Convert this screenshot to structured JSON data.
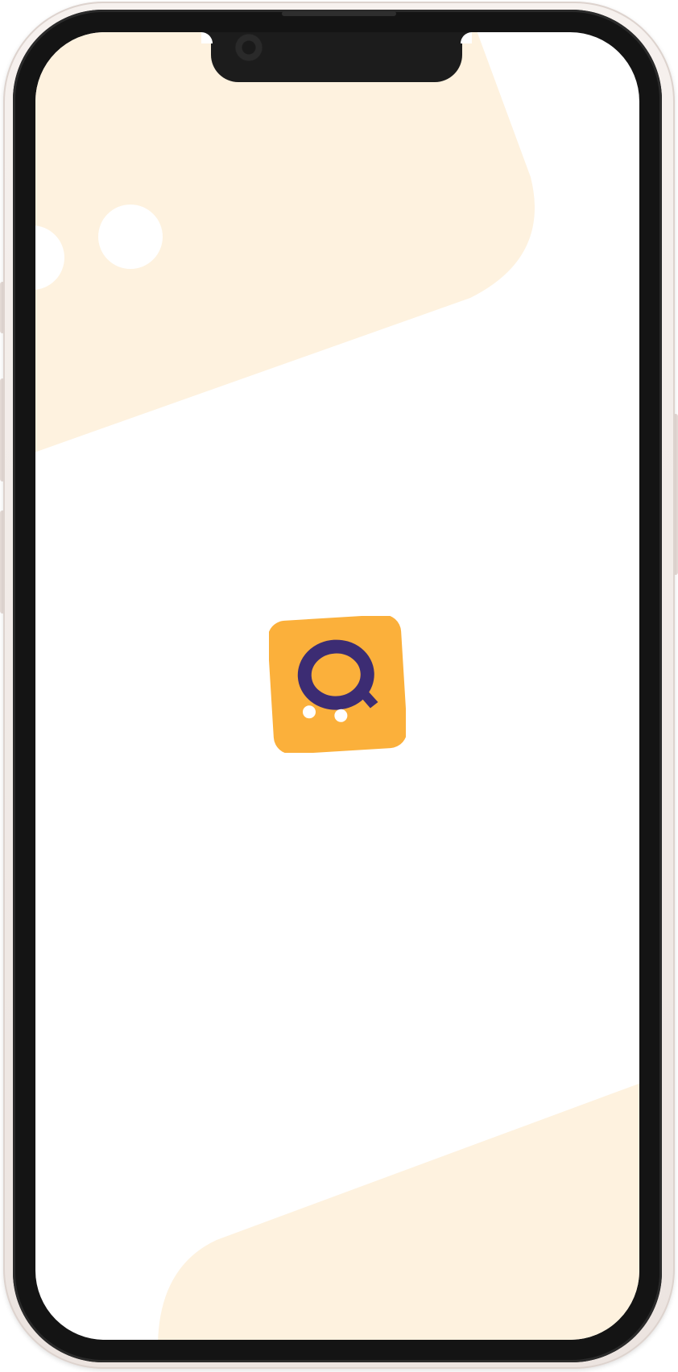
{
  "screen": {
    "name": "splash-screen",
    "accent_color": "#FBB03B",
    "logo_glyph_color": "#3C2C73",
    "background_shape_color": "#FEF2DF",
    "background_color": "#FFFFFF"
  },
  "logo": {
    "icon": "q-chat-logo-icon",
    "letter": "Q"
  }
}
